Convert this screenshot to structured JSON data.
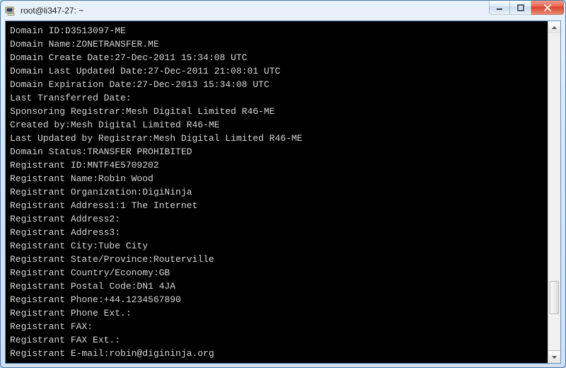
{
  "window": {
    "title": "root@li347-27: ~"
  },
  "scrollbar": {
    "thumb_top_pct": 78,
    "thumb_height_pct": 10
  },
  "terminal": {
    "lines": [
      "Domain ID:D3513097-ME",
      "Domain Name:ZONETRANSFER.ME",
      "Domain Create Date:27-Dec-2011 15:34:08 UTC",
      "Domain Last Updated Date:27-Dec-2011 21:08:01 UTC",
      "Domain Expiration Date:27-Dec-2013 15:34:08 UTC",
      "Last Transferred Date:",
      "Sponsoring Registrar:Mesh Digital Limited R46-ME",
      "Created by:Mesh Digital Limited R46-ME",
      "Last Updated by Registrar:Mesh Digital Limited R46-ME",
      "Domain Status:TRANSFER PROHIBITED",
      "Registrant ID:MNTF4E5709202",
      "Registrant Name:Robin Wood",
      "Registrant Organization:DigiNinja",
      "Registrant Address1:1 The Internet",
      "Registrant Address2:",
      "Registrant Address3:",
      "Registrant City:Tube City",
      "Registrant State/Province:Routerville",
      "Registrant Country/Economy:GB",
      "Registrant Postal Code:DN1 4JA",
      "Registrant Phone:+44.1234567890",
      "Registrant Phone Ext.:",
      "Registrant FAX:",
      "Registrant FAX Ext.:",
      "Registrant E-mail:robin@digininja.org"
    ]
  }
}
